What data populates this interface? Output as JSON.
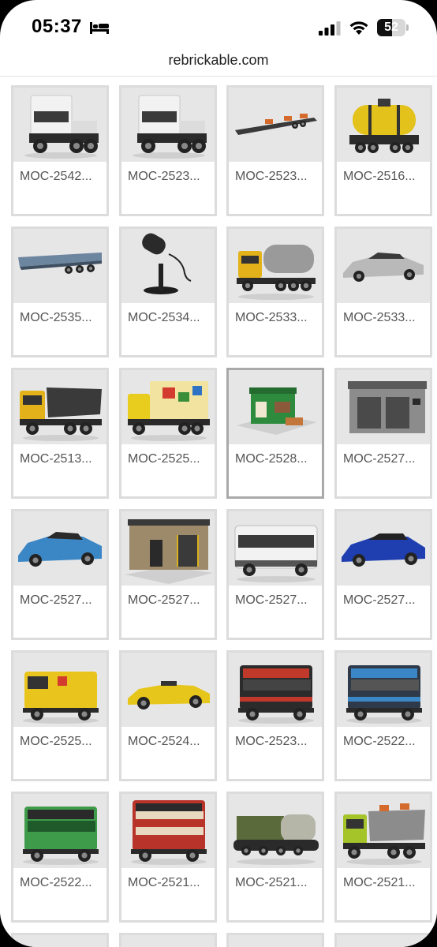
{
  "status_bar": {
    "time": "05:37",
    "sleep_icon": "bed-icon",
    "signal_icon": "cellular-signal-icon",
    "wifi_icon": "wifi-icon",
    "battery_level": "52",
    "battery_fraction": 0.52
  },
  "browser": {
    "url": "rebrickable.com"
  },
  "mocs": [
    {
      "label": "MOC-2542...",
      "thumb": "white-semi-truck"
    },
    {
      "label": "MOC-2523...",
      "thumb": "white-semi-truck"
    },
    {
      "label": "MOC-2523...",
      "thumb": "flatbed-trailer"
    },
    {
      "label": "MOC-2516...",
      "thumb": "yellow-tank-wagon"
    },
    {
      "label": "MOC-2535...",
      "thumb": "blue-flatbed-trailer"
    },
    {
      "label": "MOC-2534...",
      "thumb": "microphone"
    },
    {
      "label": "MOC-2533...",
      "thumb": "yellow-tanker-truck"
    },
    {
      "label": "MOC-2533...",
      "thumb": "silver-sports-car"
    },
    {
      "label": "MOC-2513...",
      "thumb": "yellow-dump-truck"
    },
    {
      "label": "MOC-2525...",
      "thumb": "yellow-box-truck"
    },
    {
      "label": "MOC-2528...",
      "thumb": "green-shop"
    },
    {
      "label": "MOC-2527...",
      "thumb": "grey-garage"
    },
    {
      "label": "MOC-2527...",
      "thumb": "blue-sports-car"
    },
    {
      "label": "MOC-2527...",
      "thumb": "brown-building"
    },
    {
      "label": "MOC-2527...",
      "thumb": "white-bus"
    },
    {
      "label": "MOC-2527...",
      "thumb": "dark-blue-sports-car"
    },
    {
      "label": "MOC-2525...",
      "thumb": "yellow-van"
    },
    {
      "label": "MOC-2524...",
      "thumb": "yellow-convertible"
    },
    {
      "label": "MOC-2523...",
      "thumb": "red-black-bus"
    },
    {
      "label": "MOC-2522...",
      "thumb": "blue-bus"
    },
    {
      "label": "MOC-2522...",
      "thumb": "green-bus"
    },
    {
      "label": "MOC-2521...",
      "thumb": "red-double-decker-bus"
    },
    {
      "label": "MOC-2521...",
      "thumb": "olive-tank"
    },
    {
      "label": "MOC-2521...",
      "thumb": "lime-dump-truck"
    }
  ],
  "selected_index": 10,
  "colors": {
    "card_border": "#dcdcdc",
    "thumb_bg": "#e6e6e6",
    "label_text": "#555555"
  }
}
